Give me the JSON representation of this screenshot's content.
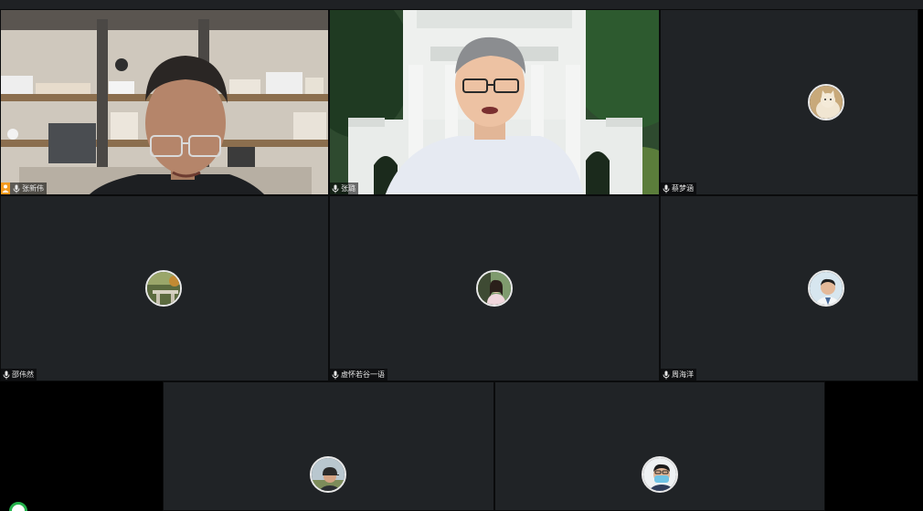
{
  "meeting": {
    "participants": [
      {
        "name": "张新伟",
        "video": true,
        "host": true
      },
      {
        "name": "张璐",
        "video": true,
        "host": false
      },
      {
        "name": "蔡梦涵",
        "video": false,
        "avatar": "cat-avatar"
      },
      {
        "name": "邵伟然",
        "video": false,
        "avatar": "garden-avatar"
      },
      {
        "name": "虚怀若谷一语",
        "video": false,
        "avatar": "woman-avatar"
      },
      {
        "name": "周海洋",
        "video": false,
        "avatar": "man-white-coat-avatar"
      },
      {
        "name": "",
        "video": false,
        "avatar": "man-cap-avatar"
      },
      {
        "name": "",
        "video": false,
        "avatar": "man-mask-avatar"
      }
    ]
  },
  "colors": {
    "tile_background": "#202326",
    "host_badge": "#f39a1e",
    "status_ring": "#24b24b"
  },
  "icons": {
    "mic": "microphone-icon",
    "host": "host-person-icon"
  }
}
